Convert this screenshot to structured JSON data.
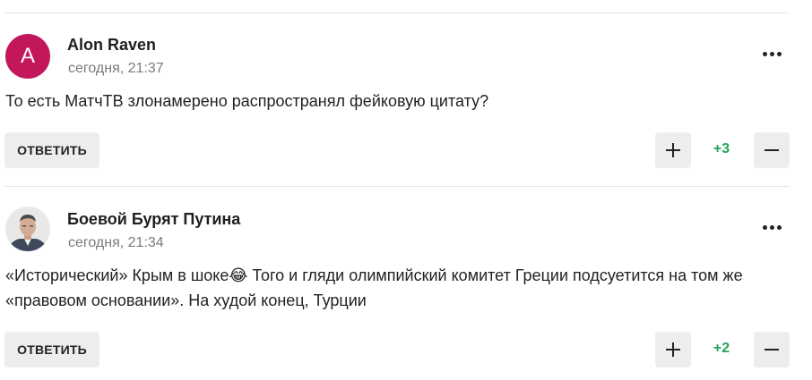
{
  "comments": [
    {
      "author": "Alon Raven",
      "avatar_letter": "A",
      "avatar_color": "#c2185b",
      "time": "сегодня, 21:37",
      "text": "То есть МатчТВ злонамерено распространял фейковую цитату?",
      "reply_label": "ОТВЕТИТЬ",
      "score": "+3"
    },
    {
      "author": "Боевой Бурят Путина",
      "avatar_letter": "",
      "time": "сегодня, 21:34",
      "text_line1": "«Исторический» Крым в шоке😂 Того и гляди олимпийский комитет Греции подсуетится на том же",
      "text_line2": "«правовом основании». На худой конец, Турции",
      "reply_label": "ОТВЕТИТЬ",
      "score": "+2"
    }
  ],
  "icons": {
    "more": "more-horizontal-icon",
    "upvote": "plus-icon",
    "downvote": "minus-icon"
  },
  "colors": {
    "score": "#22a35a",
    "button_bg": "#ededed"
  }
}
